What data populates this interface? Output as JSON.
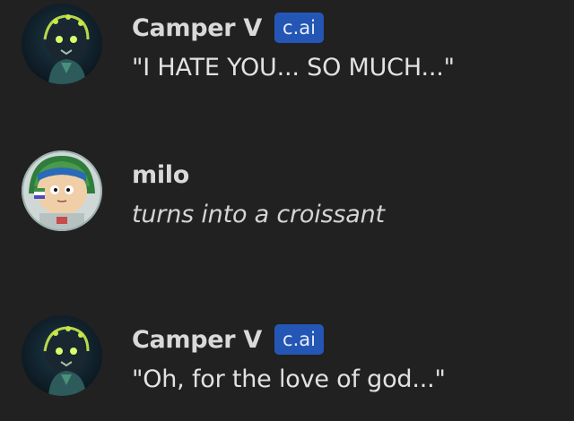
{
  "messages": [
    {
      "author": "Camper V",
      "badge": "c.ai",
      "text": "\"I HATE YOU... SO MUCH...\"",
      "avatar_icon": "robot-avatar-icon"
    },
    {
      "author": "milo",
      "badge": "",
      "text": "turns into a croissant",
      "avatar_icon": "astronaut-avatar-icon"
    },
    {
      "author": "Camper V",
      "badge": "c.ai",
      "text": "\"Oh, for the love of god...\"",
      "avatar_icon": "robot-avatar-icon"
    }
  ],
  "colors": {
    "background": "#212121",
    "badge": "#2456b5",
    "text": "#e2e2e2"
  }
}
